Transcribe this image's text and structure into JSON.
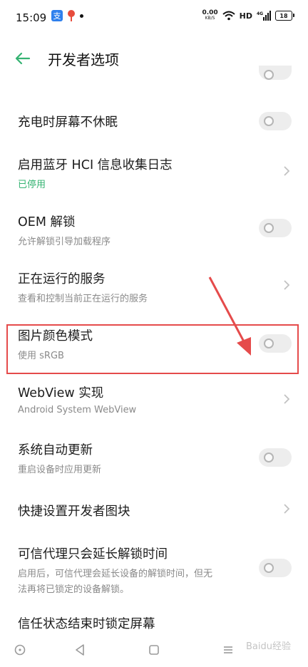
{
  "status_bar": {
    "time": "15:09",
    "badge_text": "支",
    "net_speed_value": "0.00",
    "net_speed_unit": "KB/S",
    "hd_label": "HD",
    "signal_label": "4G",
    "battery_level": "18"
  },
  "header": {
    "title": "开发者选项"
  },
  "rows": [
    {
      "title": "充电时屏幕不休眠",
      "control": "toggle",
      "on": false
    },
    {
      "title": "启用蓝牙 HCI 信息收集日志",
      "subtitle": "已停用",
      "control": "chevron"
    },
    {
      "title": "OEM 解锁",
      "subtitle": "允许解锁引导加载程序",
      "control": "toggle",
      "on": false
    },
    {
      "title": "正在运行的服务",
      "subtitle": "查看和控制当前正在运行的服务",
      "control": "chevron"
    },
    {
      "title": "图片颜色模式",
      "subtitle": "使用 sRGB",
      "control": "toggle",
      "on": false
    },
    {
      "title": "WebView 实现",
      "subtitle": "Android System WebView",
      "control": "chevron"
    },
    {
      "title": "系统自动更新",
      "subtitle": "重启设备时应用更新",
      "control": "toggle",
      "on": false
    },
    {
      "title": "快捷设置开发者图块",
      "control": "chevron"
    },
    {
      "title": "可信代理只会延长解锁时间",
      "subtitle_line1": "启用后，可信代理会延长设备的解锁时间，但无",
      "subtitle_line2": "法再将已锁定的设备解锁。",
      "control": "toggle",
      "on": false
    },
    {
      "title": "信任状态结束时锁定屏幕"
    }
  ],
  "colors": {
    "accent_green": "#35b372",
    "highlight_red": "#e54b4b"
  },
  "watermark": "Baidu经验"
}
